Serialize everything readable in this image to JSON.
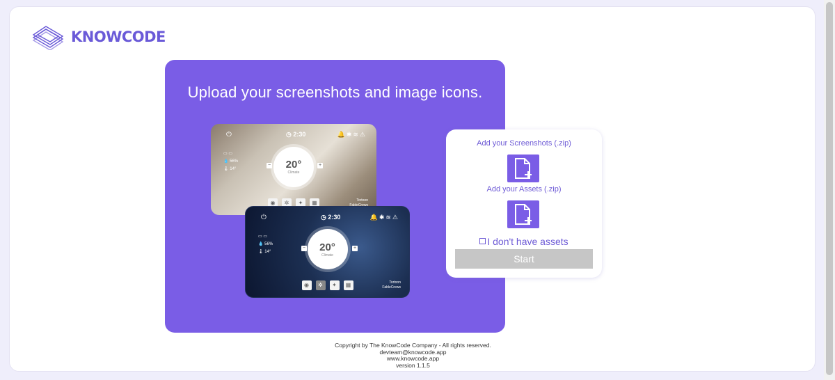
{
  "brand": {
    "name": "KNOWCODE",
    "color": "#6a5ad8",
    "logo_icon": "stacked-layers-logo"
  },
  "hero": {
    "title": "Upload your screenshots and image icons.",
    "background": "#7a5de6",
    "light_mock": {
      "clock": "2:30",
      "temperature": "20°",
      "temp_sub": "Climate",
      "humidity": "56%",
      "outdoor": "14°",
      "brand_line1": "Tortoon",
      "brand_line2": "FableCrews"
    },
    "dark_mock": {
      "clock": "2:30",
      "temperature": "20°",
      "temp_sub": "Climate",
      "humidity": "56%",
      "outdoor": "14°",
      "brand_line1": "Tortoon",
      "brand_line2": "FableCrews"
    }
  },
  "panel": {
    "screenshots_label": "Add your Screenshots (.zip)",
    "assets_label": "Add your Assets (.zip)",
    "no_assets_label": "I don't have assets",
    "no_assets_checked": false,
    "start_label": "Start",
    "accent": "#7a5de6",
    "start_bg": "#c6c6c6"
  },
  "footer": {
    "copyright": "Copyright by The KnowCode Company - All rights reserved.",
    "email": "devteam@knowcode.app",
    "website": "www.knowcode.app",
    "version": "version 1.1.5"
  }
}
